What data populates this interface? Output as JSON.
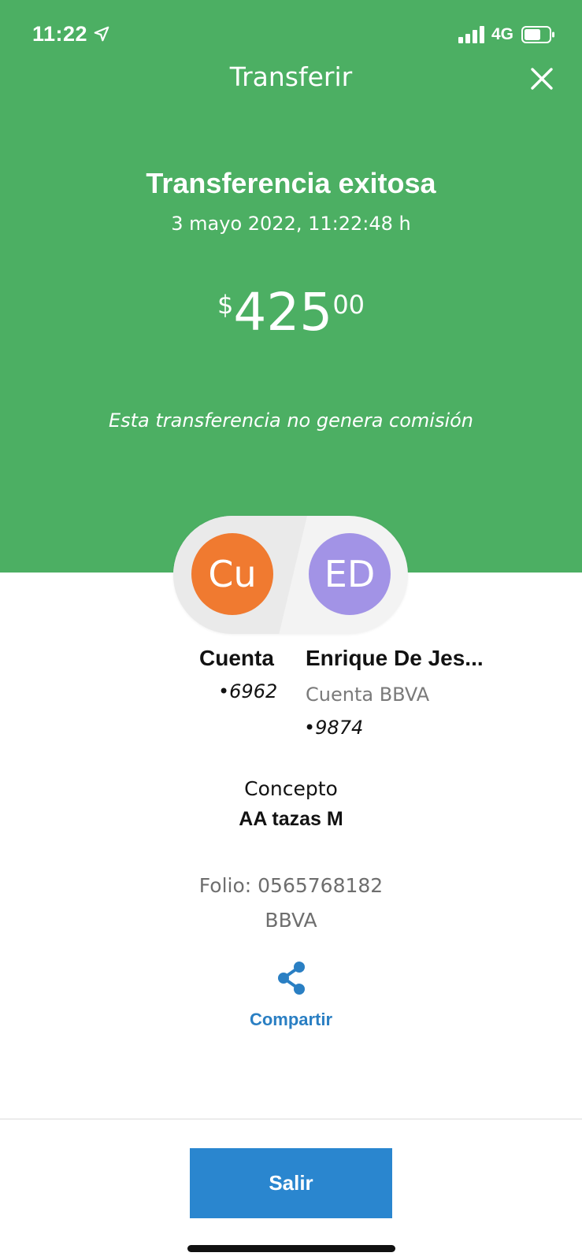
{
  "status_bar": {
    "time": "11:22",
    "network": "4G"
  },
  "nav": {
    "title": "Transferir",
    "close_icon": "close-icon"
  },
  "result": {
    "headline": "Transferencia exitosa",
    "datetime": "3 mayo 2022, 11:22:48 h",
    "amount": {
      "currency": "$",
      "integer": "425",
      "decimals": "00"
    },
    "fee_note": "Esta transferencia no genera comisión"
  },
  "origin": {
    "initials": "Cu",
    "name": "Cuenta",
    "number": "•6962"
  },
  "destination": {
    "initials": "ED",
    "name": "Enrique De Jes...",
    "account_type": "Cuenta BBVA",
    "number": "•9874"
  },
  "concept": {
    "label": "Concepto",
    "value": "AA tazas M"
  },
  "folio": "Folio: 0565768182",
  "bank": "BBVA",
  "share": {
    "label": "Compartir",
    "icon": "share-icon"
  },
  "exit_button": {
    "label": "Salir"
  },
  "colors": {
    "header_green": "#4caf63",
    "origin_avatar": "#f07a30",
    "destination_avatar": "#a293e6",
    "primary_blue": "#2a86cf",
    "link_blue": "#2a7fc3"
  }
}
